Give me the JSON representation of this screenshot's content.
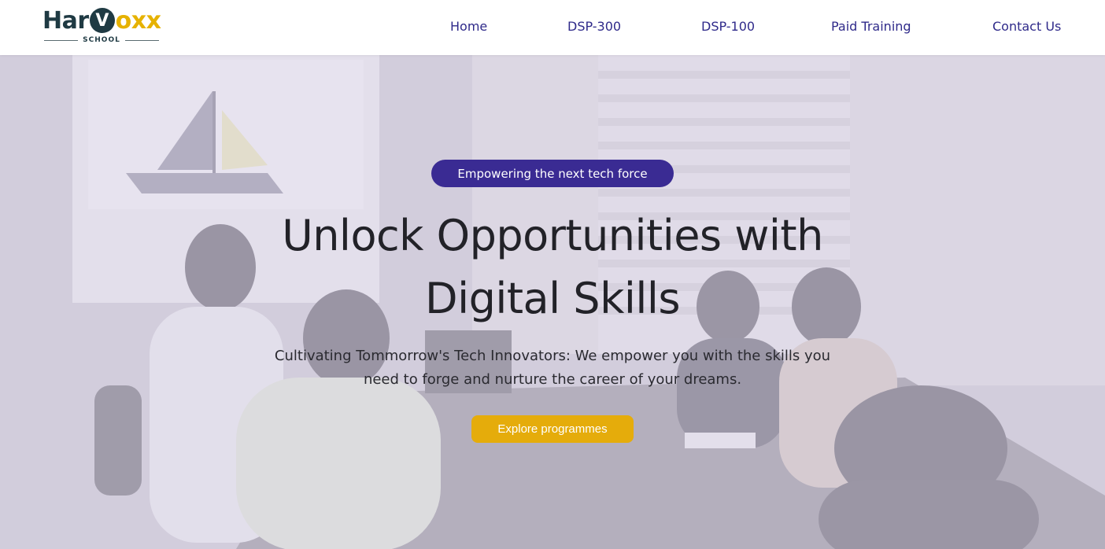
{
  "brand": {
    "logo_har": "Har",
    "logo_v": "V",
    "logo_oxx": "oxx",
    "logo_school": "SCHOOL"
  },
  "nav": {
    "items": [
      {
        "label": "Home"
      },
      {
        "label": "DSP-300"
      },
      {
        "label": "DSP-100"
      },
      {
        "label": "Paid Training"
      },
      {
        "label": "Contact Us"
      }
    ]
  },
  "hero": {
    "badge": "Empowering the next tech force",
    "headline_line1": "Unlock Opportunities with",
    "headline_line2": "Digital Skills",
    "subtext": "Cultivating Tommorrow's Tech Innovators: We empower you with the skills you need to forge and nurture the career of your dreams.",
    "cta_label": "Explore programmes"
  },
  "colors": {
    "nav_text": "#2f2a8a",
    "badge_bg": "#3a2b93",
    "cta_bg": "#e5ac0b",
    "logo_dark": "#1f3a43",
    "logo_accent": "#e6b200"
  }
}
